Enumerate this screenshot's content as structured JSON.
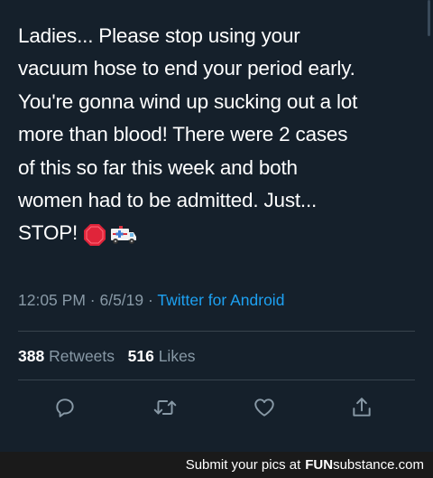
{
  "tweet": {
    "text": "Ladies... Please stop using your\nvacuum hose to end your period early.\nYou're gonna wind up sucking out a lot\nmore than blood! There were 2 cases\nof this so far this week and both\nwomen had to be admitted. Just...\nSTOP!",
    "emojis": [
      "stop-sign-icon",
      "ambulance-icon"
    ],
    "time": "12:05 PM",
    "date": "6/5/19",
    "source": "Twitter for Android",
    "retweets_count": "388",
    "retweets_label": "Retweets",
    "likes_count": "516",
    "likes_label": "Likes"
  },
  "actions": [
    "reply-icon",
    "retweet-icon",
    "like-icon",
    "share-icon"
  ],
  "footer": {
    "prefix": "Submit your pics at",
    "brand_bold": "FUN",
    "brand_rest": "substance",
    "brand_tld": ".com"
  },
  "colors": {
    "background": "#15202b",
    "text": "#ffffff",
    "muted": "#8899a6",
    "link": "#1da1f2"
  }
}
